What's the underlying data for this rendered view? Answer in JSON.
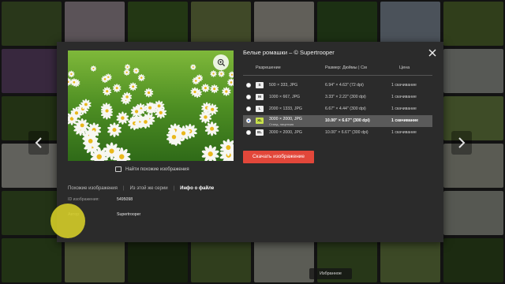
{
  "colors": {
    "accent": "#e2473a",
    "selected_badge": "#c8e04a",
    "modal_bg": "#2b2b2b"
  },
  "background_tiles": [
    "#5b7a3a",
    "#c9b9c4",
    "#4f7a2e",
    "#8ea35a",
    "#d8d2c6",
    "#3e6b2a",
    "#a7b6c8",
    "#6c8a3d",
    "#7c5a8a",
    "#3a5e22",
    "#2f4e1e",
    "#8aa24e",
    "#b3b9a4",
    "#4a6b30",
    "#78934a",
    "#c0c6bd",
    "#4c6e2e",
    "#9cb06a",
    "#3d5c24",
    "#6d8840",
    "#a1b47a",
    "#567a34",
    "#2e4a1c",
    "#8ba857",
    "#d7d7cc",
    "#5a7f3a",
    "#7fa04d",
    "#436a2a",
    "#b1c08a",
    "#3c5d25",
    "#6a8b43",
    "#c7cbb8",
    "#4e7131",
    "#8aa55c",
    "#d9d9cf",
    "#5d7f3c",
    "#96ae66",
    "#365a20",
    "#728f48",
    "#bfc4b5",
    "#4a6f2d",
    "#a2b46f",
    "#314f1d",
    "#6b8a42",
    "#c9cdbd",
    "#587b37",
    "#85a255",
    "#3f6126"
  ],
  "nav": {
    "prev_icon": "chevron-left-icon",
    "next_icon": "chevron-right-icon"
  },
  "modal": {
    "title": "Белые ромашки  –  © Supertrooper",
    "close_icon": "close-icon",
    "zoom_icon": "zoom-in-icon",
    "similar_label": "Найти похожие изображения",
    "tabs": [
      {
        "label": "Похожие изображения"
      },
      {
        "label": "Из этой же серии"
      },
      {
        "label": "Инфо о файле"
      }
    ],
    "info": [
      {
        "key": "ID изображения:",
        "value": "5495098"
      },
      {
        "key": "Автор:",
        "value": "Supertrooper"
      }
    ],
    "table": {
      "headers": {
        "resolution": "Разрешение",
        "size": "Размер: Дюймы | См",
        "price": "Цена"
      },
      "rows": [
        {
          "badge": "S",
          "resolution": "500 × 333, JPG",
          "note": "",
          "size": "6.94\" × 4.63\" (72 dpi)",
          "price": "1 скачивание",
          "selected": false
        },
        {
          "badge": "M",
          "resolution": "1000 × 667, JPG",
          "note": "",
          "size": "3.33\" × 2.22\" (300 dpi)",
          "price": "1 скачивание",
          "selected": false
        },
        {
          "badge": "L",
          "resolution": "2000 × 1333, JPG",
          "note": "",
          "size": "6.67\" × 4.44\" (300 dpi)",
          "price": "1 скачивание",
          "selected": false
        },
        {
          "badge": "XL",
          "resolution": "3000 × 2000, JPG",
          "note": "Станд. лицензия",
          "size": "10.00\" × 6.67\" (300 dpi)",
          "price": "1 скачивание",
          "selected": true
        },
        {
          "badge": "EL",
          "resolution": "3000 × 2000, JPG",
          "note": "",
          "size": "10.00\" × 6.67\" (300 dpi)",
          "price": "1 скачивание",
          "selected": false
        }
      ]
    },
    "download_label": "Скачать изображение"
  },
  "favorites_label": "Избранное"
}
